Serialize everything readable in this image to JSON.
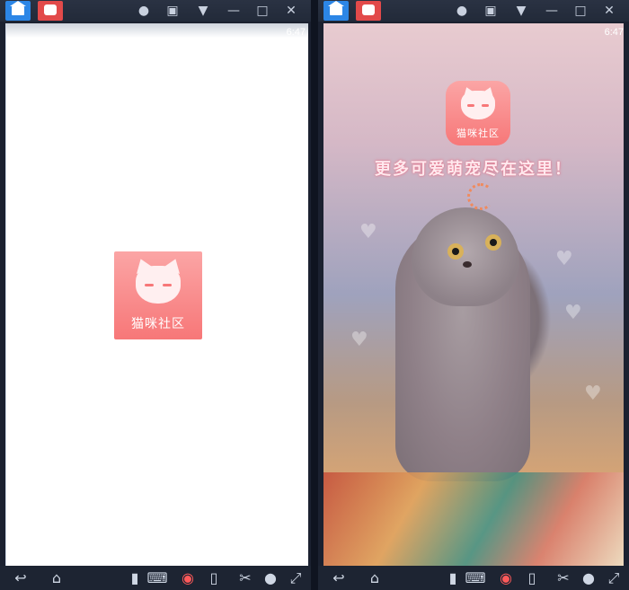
{
  "left_screen": {
    "status_time": "6:47",
    "logo_text": "猫咪社区"
  },
  "right_screen": {
    "status_time": "6:47",
    "logo_text": "猫咪社区",
    "slogan": "更多可爱萌宠尽在这里！"
  },
  "toolbar_icons": [
    "home-tab-icon",
    "app-tab-icon",
    "account-icon",
    "shirt-icon",
    "wifi-icon",
    "minimize-icon",
    "maximize-icon",
    "close-icon"
  ],
  "bottom_icons": [
    "back-icon",
    "home-icon",
    "rotate-icon",
    "keyboard-icon",
    "eye-icon",
    "phone-icon",
    "scissors-icon",
    "location-icon",
    "fullscreen-icon"
  ],
  "colors": {
    "logo_gradient_top": "#fba5a5",
    "logo_gradient_bottom": "#f77778",
    "home_tab": "#2c86e6",
    "app_tab": "#e24a4a",
    "chrome": "#222a39"
  }
}
